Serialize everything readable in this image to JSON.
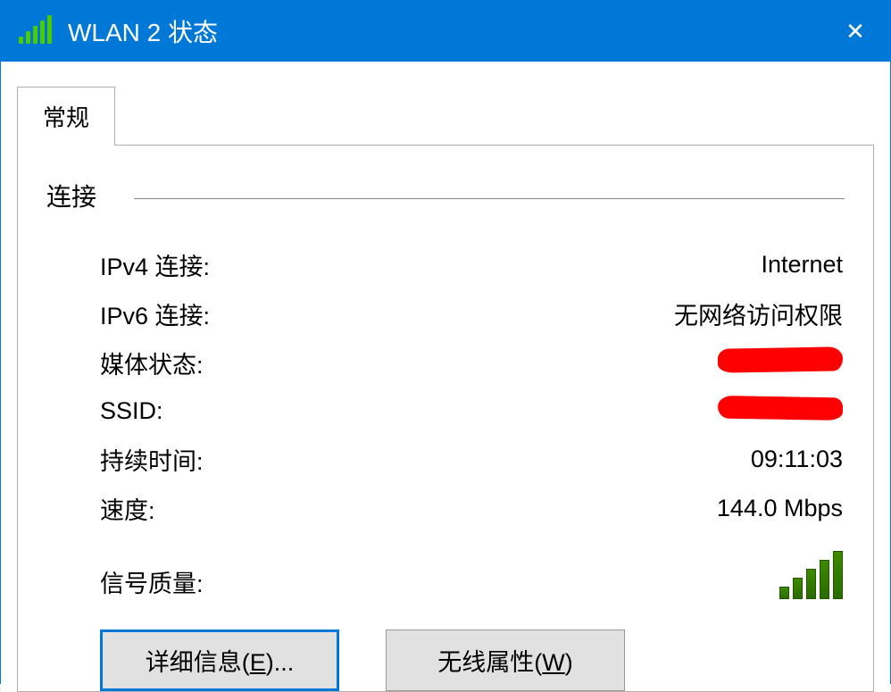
{
  "window": {
    "title": "WLAN 2 状态"
  },
  "tabs": {
    "general": "常规"
  },
  "section": {
    "connection": "连接"
  },
  "rows": {
    "ipv4_label": "IPv4 连接:",
    "ipv4_value": "Internet",
    "ipv6_label": "IPv6 连接:",
    "ipv6_value": "无网络访问权限",
    "media_label": "媒体状态:",
    "ssid_label": "SSID:",
    "duration_label": "持续时间:",
    "duration_value": "09:11:03",
    "speed_label": "速度:",
    "speed_value": "144.0 Mbps",
    "signal_label": "信号质量:"
  },
  "buttons": {
    "details_pre": "详细信息(",
    "details_key": "E",
    "details_post": ")...",
    "wireless_pre": "无线属性(",
    "wireless_key": "W",
    "wireless_post": ")"
  }
}
